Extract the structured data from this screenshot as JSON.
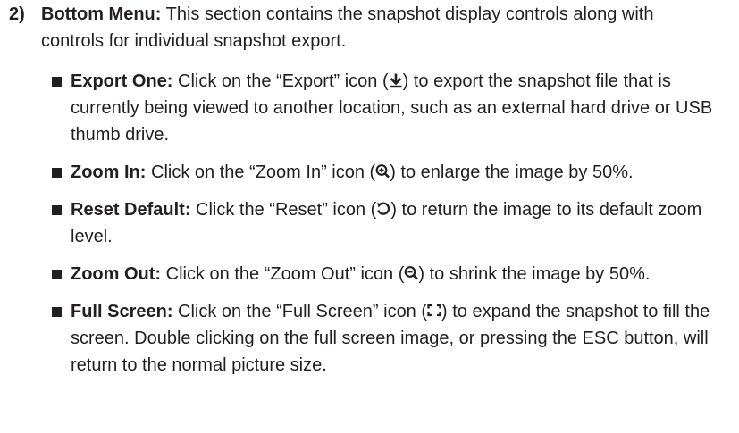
{
  "section": {
    "number": "2)",
    "title": "Bottom Menu:",
    "intro": " This section contains the snapshot display controls along with controls for individual snapshot export."
  },
  "items": [
    {
      "title": "Export One:",
      "before": " Click on the “Export” icon (",
      "icon": "export-icon",
      "after": ") to export the snapshot file that is currently being viewed to another location, such as an external hard drive or USB thumb drive."
    },
    {
      "title": "Zoom In:",
      "before": " Click on the “Zoom In” icon (",
      "icon": "zoom-in-icon",
      "after": ") to enlarge the image by 50%."
    },
    {
      "title": "Reset Default:",
      "before": " Click the “Reset” icon (",
      "icon": "reset-icon",
      "after": ") to return the image to its default zoom level."
    },
    {
      "title": "Zoom Out:",
      "before": " Click on the “Zoom Out” icon (",
      "icon": "zoom-out-icon",
      "after": ") to shrink the image by 50%."
    },
    {
      "title": "Full Screen:",
      "before": " Click on the “Full Screen” icon (",
      "icon": "full-screen-icon",
      "after": ") to expand the snapshot to fill the screen. Double clicking on the full screen image, or pressing the ESC button, will return to the normal picture size."
    }
  ]
}
